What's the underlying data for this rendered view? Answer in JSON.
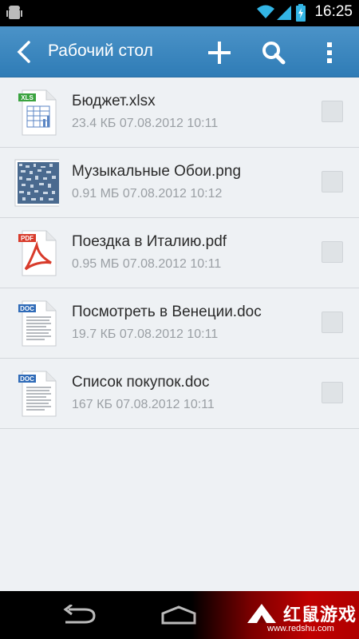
{
  "status_bar": {
    "time": "16:25"
  },
  "action_bar": {
    "title": "Рабочий стол"
  },
  "files": [
    {
      "name": "Бюджет.xlsx",
      "meta": "23.4 КБ 07.08.2012 10:11",
      "icon": "xls-file-icon",
      "badge": "XLS",
      "badge_color": "#3aa33f"
    },
    {
      "name": "Музыкальные Обои.png",
      "meta": "0.91 МБ 07.08.2012 10:12",
      "icon": "image-thumbnail-icon"
    },
    {
      "name": "Поездка в Италию.pdf",
      "meta": "0.95 МБ 07.08.2012 10:11",
      "icon": "pdf-file-icon",
      "badge": "PDF",
      "badge_color": "#d83b2b"
    },
    {
      "name": "Посмотреть в Венеции.doc",
      "meta": "19.7 КБ 07.08.2012 10:11",
      "icon": "doc-file-icon",
      "badge": "DOC",
      "badge_color": "#2f6bb8"
    },
    {
      "name": "Список покупок.doc",
      "meta": "167 КБ 07.08.2012 10:11",
      "icon": "doc-file-icon",
      "badge": "DOC",
      "badge_color": "#2f6bb8"
    }
  ],
  "watermark": {
    "main": "红鼠游戏",
    "url": "www.redshu.com"
  },
  "colors": {
    "action_bar": "#3a86bf",
    "background": "#eef1f4"
  }
}
